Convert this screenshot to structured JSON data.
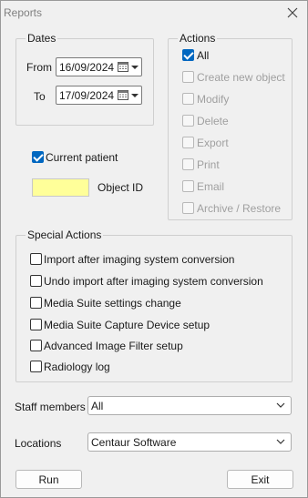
{
  "window": {
    "title": "Reports"
  },
  "dates": {
    "legend": "Dates",
    "from_label": "From",
    "from_value": "16/09/2024",
    "to_label": "To",
    "to_value": "17/09/2024"
  },
  "actions": {
    "legend": "Actions",
    "items": [
      {
        "label": "All",
        "checked": true,
        "enabled": true
      },
      {
        "label": "Create new object",
        "checked": false,
        "enabled": false
      },
      {
        "label": "Modify",
        "checked": false,
        "enabled": false
      },
      {
        "label": "Delete",
        "checked": false,
        "enabled": false
      },
      {
        "label": "Export",
        "checked": false,
        "enabled": false
      },
      {
        "label": "Print",
        "checked": false,
        "enabled": false
      },
      {
        "label": "Email",
        "checked": false,
        "enabled": false
      },
      {
        "label": "Archive / Restore",
        "checked": false,
        "enabled": false
      }
    ]
  },
  "current_patient": {
    "label": "Current patient",
    "checked": true
  },
  "object_id": {
    "label": "Object ID",
    "value": ""
  },
  "special_actions": {
    "legend": "Special Actions",
    "items": [
      {
        "label": "Import after imaging system conversion",
        "checked": false
      },
      {
        "label": "Undo import after imaging system conversion",
        "checked": false
      },
      {
        "label": "Media Suite settings change",
        "checked": false
      },
      {
        "label": "Media Suite Capture Device setup",
        "checked": false
      },
      {
        "label": "Advanced Image Filter setup",
        "checked": false
      },
      {
        "label": "Radiology log",
        "checked": false
      }
    ]
  },
  "staff": {
    "label": "Staff members",
    "value": "All"
  },
  "locations": {
    "label": "Locations",
    "value": "Centaur Software"
  },
  "buttons": {
    "run": "Run",
    "exit": "Exit"
  }
}
